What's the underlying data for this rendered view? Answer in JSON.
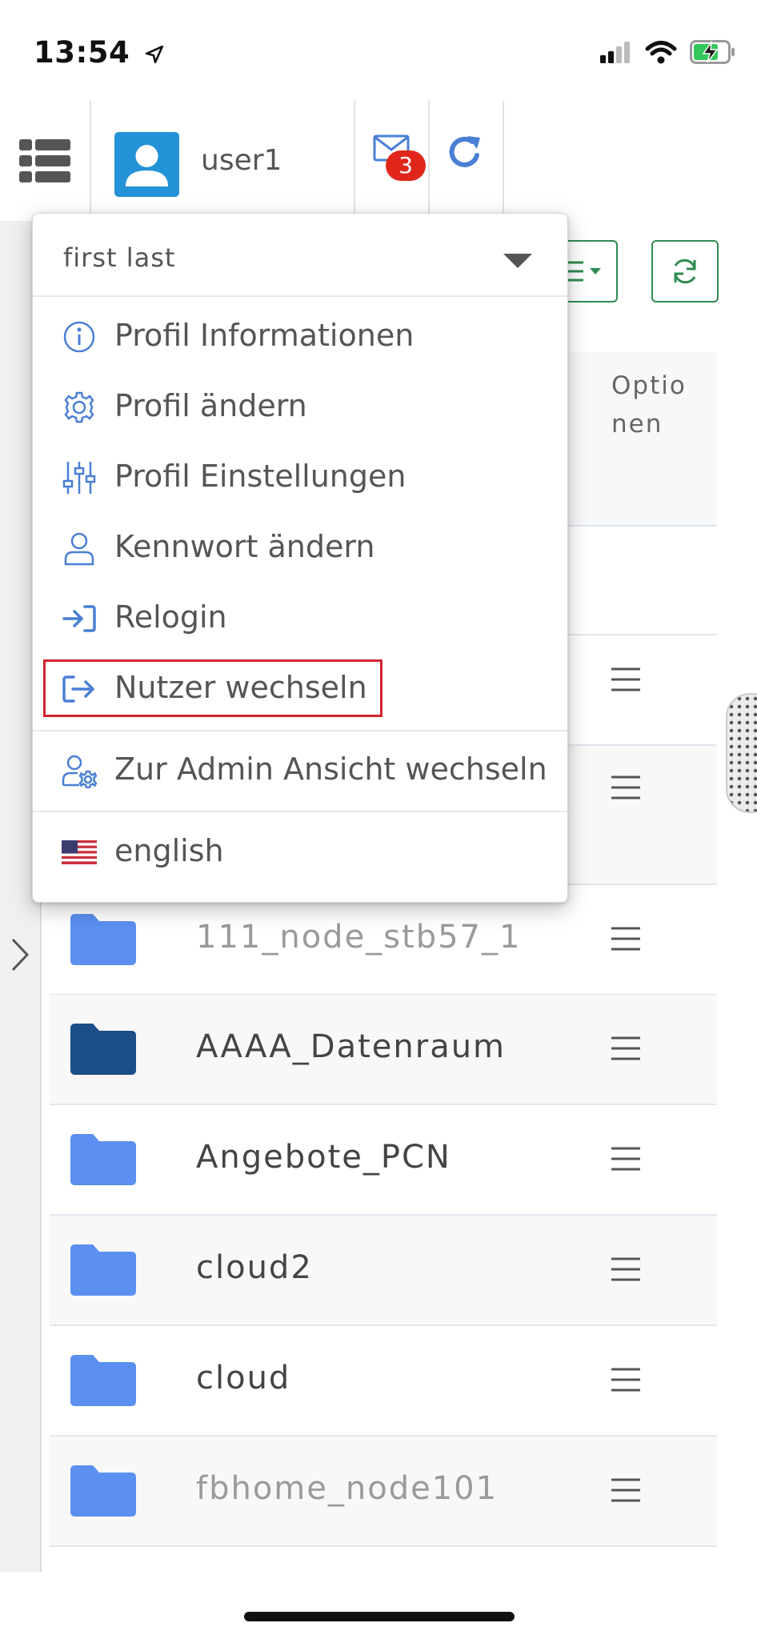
{
  "status_bar": {
    "time": "13:54",
    "icons": [
      "location-arrow-icon",
      "signal-icon",
      "wifi-icon",
      "battery-charging-icon"
    ]
  },
  "header": {
    "username": "user1",
    "unread_messages": "3",
    "icons": [
      "menu-list-icon",
      "user-avatar-icon",
      "envelope-icon",
      "refresh-icon"
    ],
    "accent_color": "#2492d6",
    "badge_color": "#e0261b"
  },
  "dropdown": {
    "full_name": "first last",
    "items": [
      {
        "label": "Profil Informationen",
        "icon": "info-circle-icon"
      },
      {
        "label": "Profil ändern",
        "icon": "gear-icon"
      },
      {
        "label": "Profil Einstellungen",
        "icon": "sliders-icon"
      },
      {
        "label": "Kennwort ändern",
        "icon": "user-outline-icon"
      },
      {
        "label": "Relogin",
        "icon": "sign-in-icon"
      },
      {
        "label": "Nutzer wechseln",
        "icon": "sign-out-icon"
      },
      {
        "label": "Zur Admin Ansicht wechseln",
        "icon": "user-gear-icon"
      },
      {
        "label": "english",
        "icon": "us-flag-icon"
      }
    ],
    "highlighted_item": "Nutzer wechseln",
    "highlight_color": "#d2232f",
    "icon_color": "#4a7fd4"
  },
  "toolbar": {
    "accent_color": "#2e8b50",
    "icons": [
      "list-menu-dropdown-icon",
      "sync-icon"
    ]
  },
  "table": {
    "options_header": "Optio nen",
    "rows": [
      {
        "name": "111_node_stb57_1",
        "muted": true,
        "folder_color": "#5b8ff0"
      },
      {
        "name": "AAAA_Datenraum",
        "muted": false,
        "folder_color": "#1b4d86"
      },
      {
        "name": "Angebote_PCN",
        "muted": false,
        "folder_color": "#5b8ff0"
      },
      {
        "name": "cloud2",
        "muted": false,
        "folder_color": "#5b8ff0"
      },
      {
        "name": "cloud",
        "muted": false,
        "folder_color": "#5b8ff0"
      },
      {
        "name": "fbhome_node101",
        "muted": true,
        "folder_color": "#5b8ff0"
      }
    ]
  }
}
